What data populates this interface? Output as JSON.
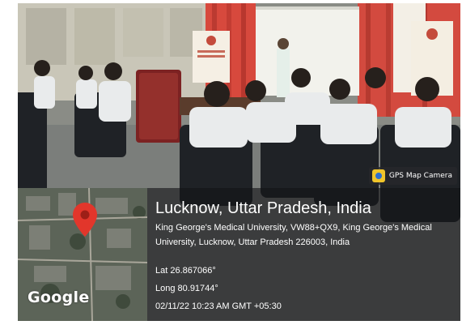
{
  "overlay": {
    "camera_badge_label": "GPS Map Camera",
    "camera_icon": "gps-map-camera-icon",
    "map_logo": "Google",
    "pin_icon": "map-pin-icon",
    "title": "Lucknow, Uttar Pradesh, India",
    "address": "King George's Medical University, VW88+QX9, King George's Medical University, Lucknow, Uttar Pradesh 226003, India",
    "latitude": "Lat 26.867066°",
    "longitude": "Long 80.91744°",
    "timestamp": "02/11/22 10:23 AM GMT +05:30"
  },
  "colors": {
    "pin": "#e2362b",
    "panel": "#141416",
    "curtain": "#d9463c",
    "screen": "#f4f4ef"
  }
}
